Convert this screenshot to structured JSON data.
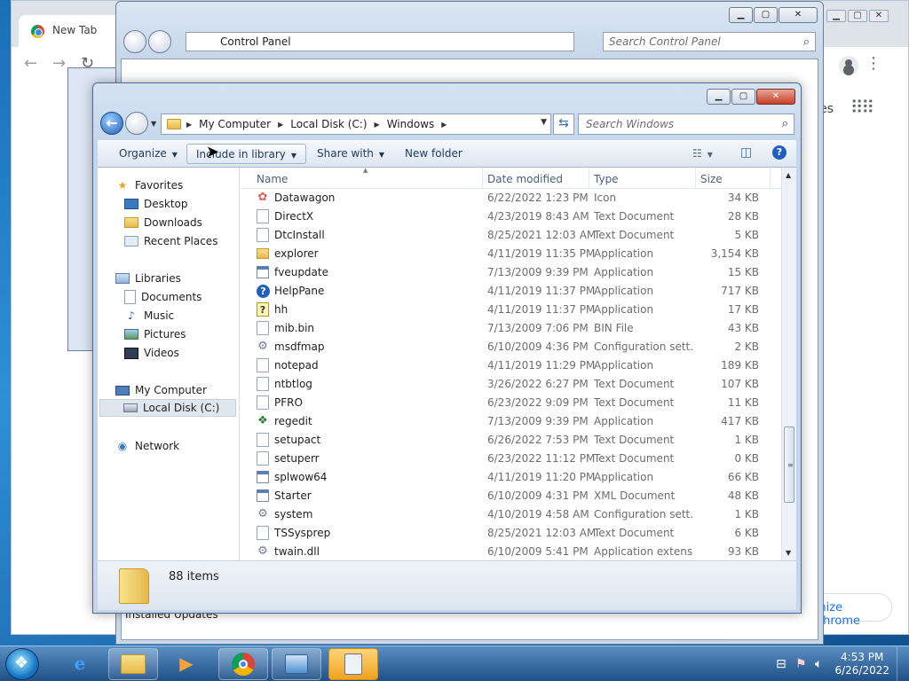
{
  "chrome": {
    "tab_title": "New Tab",
    "partial_text": "es",
    "customize_label": "mize Chrome"
  },
  "control_panel": {
    "address": "Control Panel",
    "search_placeholder": "Search Control Panel",
    "installed_updates": "Installed Updates"
  },
  "explorer": {
    "breadcrumbs": [
      "My Computer",
      "Local Disk (C:)",
      "Windows"
    ],
    "search_placeholder": "Search Windows",
    "toolbar": {
      "organize": "Organize",
      "include_in_library": "Include in library",
      "share_with": "Share with",
      "new_folder": "New folder"
    },
    "nav": {
      "favorites": "Favorites",
      "desktop": "Desktop",
      "downloads": "Downloads",
      "recent_places": "Recent Places",
      "libraries": "Libraries",
      "documents": "Documents",
      "music": "Music",
      "pictures": "Pictures",
      "videos": "Videos",
      "my_computer": "My Computer",
      "local_disk": "Local Disk (C:)",
      "network": "Network"
    },
    "columns": {
      "name": "Name",
      "date": "Date modified",
      "type": "Type",
      "size": "Size"
    },
    "files": [
      {
        "name": "Datawagon",
        "date": "6/22/2022 1:23 PM",
        "type": "Icon",
        "size": "34 KB",
        "icon": "flower-icon"
      },
      {
        "name": "DirectX",
        "date": "4/23/2019 8:43 AM",
        "type": "Text Document",
        "size": "28 KB",
        "icon": "doc-icon"
      },
      {
        "name": "DtcInstall",
        "date": "8/25/2021 12:03 AM",
        "type": "Text Document",
        "size": "5 KB",
        "icon": "doc-icon"
      },
      {
        "name": "explorer",
        "date": "4/11/2019 11:35 PM",
        "type": "Application",
        "size": "3,154 KB",
        "icon": "folder-icon"
      },
      {
        "name": "fveupdate",
        "date": "7/13/2009 9:39 PM",
        "type": "Application",
        "size": "15 KB",
        "icon": "app-icon"
      },
      {
        "name": "HelpPane",
        "date": "4/11/2019 11:37 PM",
        "type": "Application",
        "size": "717 KB",
        "icon": "help-icon"
      },
      {
        "name": "hh",
        "date": "4/11/2019 11:37 PM",
        "type": "Application",
        "size": "17 KB",
        "icon": "hh-icon"
      },
      {
        "name": "mib.bin",
        "date": "7/13/2009 7:06 PM",
        "type": "BIN File",
        "size": "43 KB",
        "icon": "doc-icon"
      },
      {
        "name": "msdfmap",
        "date": "6/10/2009 4:36 PM",
        "type": "Configuration sett...",
        "size": "2 KB",
        "icon": "gear-icon"
      },
      {
        "name": "notepad",
        "date": "4/11/2019 11:29 PM",
        "type": "Application",
        "size": "189 KB",
        "icon": "notepad-icon"
      },
      {
        "name": "ntbtlog",
        "date": "3/26/2022 6:27 PM",
        "type": "Text Document",
        "size": "107 KB",
        "icon": "doc-icon"
      },
      {
        "name": "PFRO",
        "date": "6/23/2022 9:09 PM",
        "type": "Text Document",
        "size": "11 KB",
        "icon": "doc-icon"
      },
      {
        "name": "regedit",
        "date": "7/13/2009 9:39 PM",
        "type": "Application",
        "size": "417 KB",
        "icon": "regedit-icon"
      },
      {
        "name": "setupact",
        "date": "6/26/2022 7:53 PM",
        "type": "Text Document",
        "size": "1 KB",
        "icon": "doc-icon"
      },
      {
        "name": "setuperr",
        "date": "6/23/2022 11:12 PM",
        "type": "Text Document",
        "size": "0 KB",
        "icon": "doc-icon"
      },
      {
        "name": "splwow64",
        "date": "4/11/2019 11:20 PM",
        "type": "Application",
        "size": "66 KB",
        "icon": "app-icon"
      },
      {
        "name": "Starter",
        "date": "6/10/2009 4:31 PM",
        "type": "XML Document",
        "size": "48 KB",
        "icon": "xml-icon"
      },
      {
        "name": "system",
        "date": "4/10/2019 4:58 AM",
        "type": "Configuration sett...",
        "size": "1 KB",
        "icon": "gear-icon"
      },
      {
        "name": "TSSysprep",
        "date": "8/25/2021 12:03 AM",
        "type": "Text Document",
        "size": "6 KB",
        "icon": "doc-icon"
      },
      {
        "name": "twain.dll",
        "date": "6/10/2009 5:41 PM",
        "type": "Application extens...",
        "size": "93 KB",
        "icon": "dll-icon"
      }
    ],
    "item_count": "88 items"
  },
  "taskbar": {
    "time": "4:53 PM",
    "date": "6/26/2022"
  }
}
